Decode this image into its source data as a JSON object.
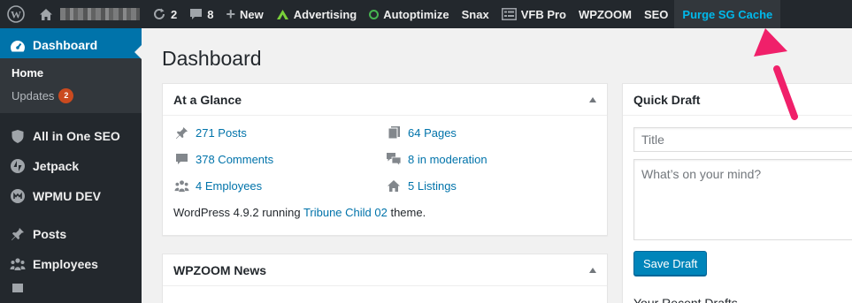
{
  "adminbar": {
    "updates_count": "2",
    "comments_count": "8",
    "new_label": "New",
    "advertising_label": "Advertising",
    "autoptimize_label": "Autoptimize",
    "snax_label": "Snax",
    "vfb_label": "VFB Pro",
    "wpzoom_label": "WPZOOM",
    "seo_label": "SEO",
    "purge_label": "Purge SG Cache"
  },
  "sidebar": {
    "dashboard_label": "Dashboard",
    "home_label": "Home",
    "updates_label": "Updates",
    "updates_badge": "2",
    "aioseo_label": "All in One SEO",
    "jetpack_label": "Jetpack",
    "wpmudev_label": "WPMU DEV",
    "posts_label": "Posts",
    "employees_label": "Employees"
  },
  "page": {
    "title": "Dashboard"
  },
  "at_a_glance": {
    "title": "At a Glance",
    "posts": "271 Posts",
    "pages": "64 Pages",
    "comments": "378 Comments",
    "moderation": "8 in moderation",
    "employees": "4 Employees",
    "listings": "5 Listings",
    "version_prefix": "WordPress 4.9.2 running ",
    "theme_link": "Tribune Child 02",
    "version_suffix": " theme."
  },
  "wpzoom_news": {
    "title": "WPZOOM News"
  },
  "quick_draft": {
    "title": "Quick Draft",
    "title_placeholder": "Title",
    "content_placeholder": "What’s on your mind?",
    "save_label": "Save Draft",
    "recent_drafts_label": "Your Recent Drafts"
  },
  "colors": {
    "adminbar_bg": "#23282d",
    "accent": "#0073aa",
    "purge_link": "#00b9eb",
    "badge": "#ca4a1f",
    "annotation_arrow": "#f0206a"
  }
}
